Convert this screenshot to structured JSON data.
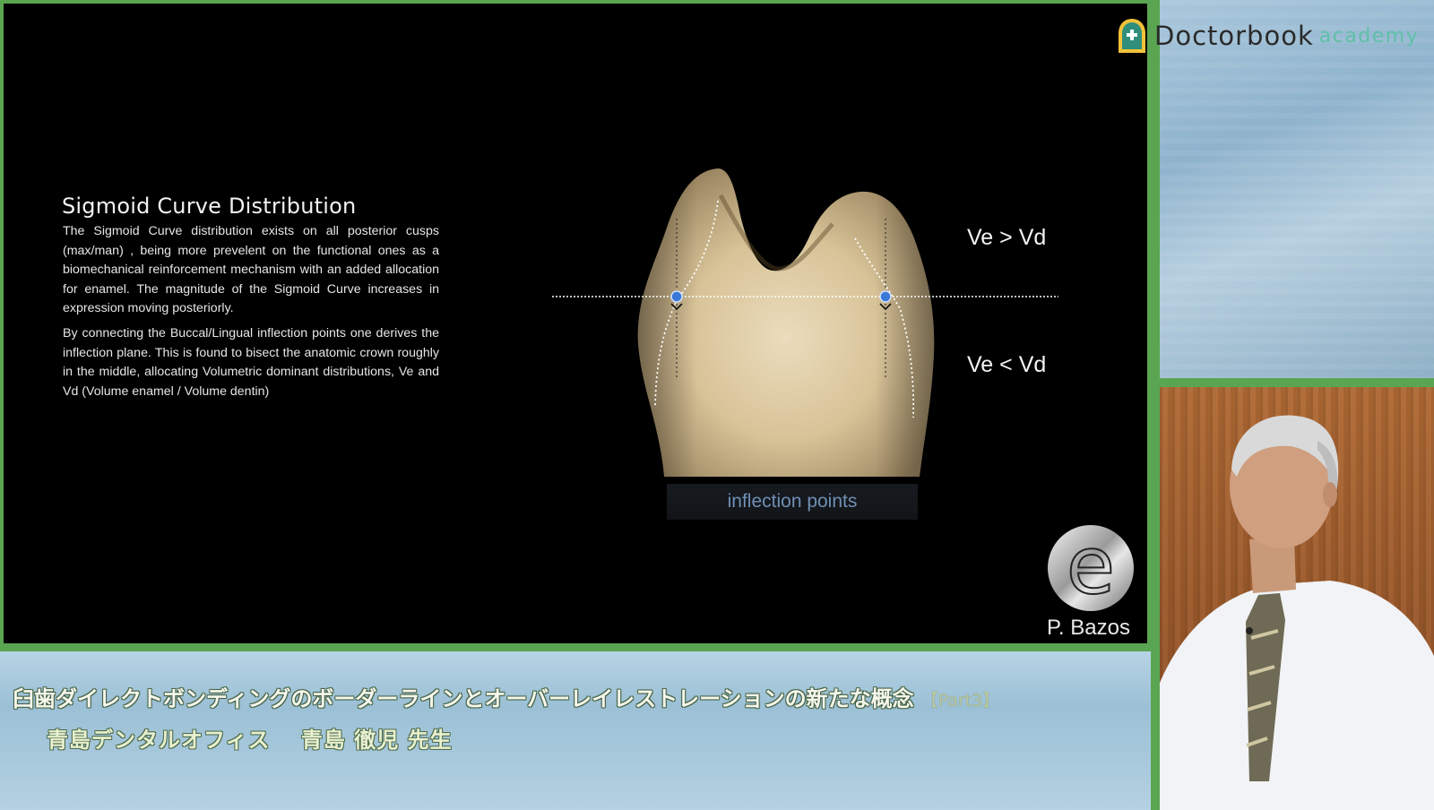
{
  "brand": {
    "name": "Doctorbook",
    "suffix": "academy"
  },
  "slide": {
    "heading": "Sigmoid Curve Distribution",
    "paragraph1": "The Sigmoid Curve distribution exists on all posterior cusps (max/man) , being more prevelent on the functional ones as a biomechanical reinforcement mechanism with an added allocation for enamel. The magnitude of the Sigmoid Curve increases in expression moving posteriorly.",
    "paragraph2": "By connecting the Buccal/Lingual inflection points one derives the inflection plane. This is found to bisect the anatomic crown roughly in the middle, allocating Volumetric dominant distributions, Ve and Vd (Volume enamel / Volume dentin)",
    "label_top": "Ve > Vd",
    "label_bottom": "Ve < Vd",
    "caption": "inflection points",
    "author_logo_letter": "e",
    "author": "P. Bazos"
  },
  "banner": {
    "title": "臼歯ダイレクトボンディングのボーダーラインとオーバーレイレストレーションの新たな概念",
    "part": "【Part3】",
    "presenter": "青島デンタルオフィス　 青島 徹児 先生"
  },
  "colors": {
    "frame_green": "#5aa552",
    "brand_suffix": "#5fc0a8",
    "caption_blue": "#6f8fb4"
  }
}
